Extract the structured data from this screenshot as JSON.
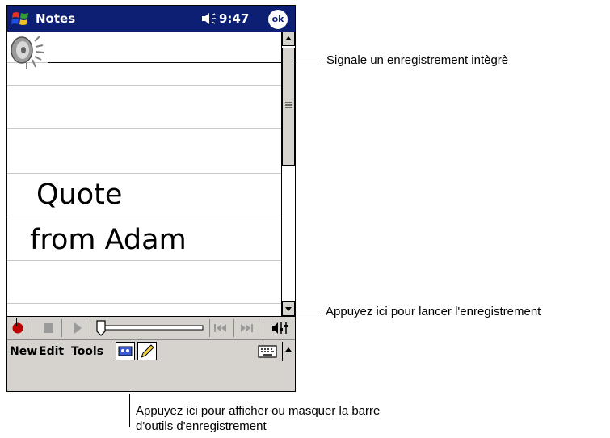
{
  "titlebar": {
    "app_title": "Notes",
    "time": "9:47",
    "ok_label": "ok"
  },
  "note": {
    "lines": [
      "Quote",
      "from Adam"
    ]
  },
  "command_bar": {
    "menus": [
      "New",
      "Edit",
      "Tools"
    ]
  },
  "callouts": {
    "embedded_recording": "Signale un enregistrement intègrè",
    "start_recording": "Appuyez ici pour lancer l'enregistrement",
    "toggle_toolbar_line1": "Appuyez ici pour afficher ou masquer la barre",
    "toggle_toolbar_line2": "d'outils d'enregistrement"
  },
  "colors": {
    "titlebar": "#0d1f73",
    "toolbar": "#d6d3ce",
    "record": "#c00000"
  },
  "icons": {
    "start": "windows-flag-icon",
    "volume": "speaker-volume-icon",
    "embedded": "speaker-recording-icon",
    "keyboard": "keyboard-icon"
  }
}
